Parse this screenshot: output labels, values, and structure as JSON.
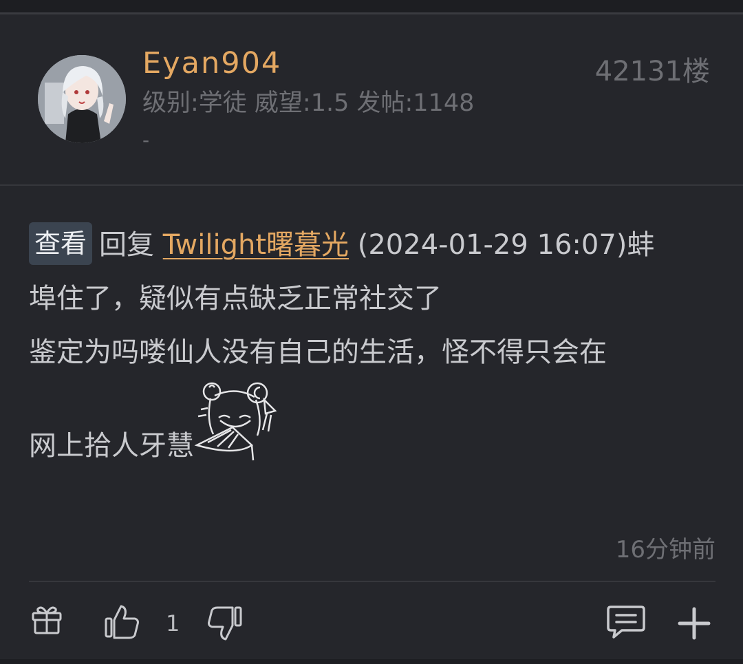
{
  "post": {
    "username": "Eyan904",
    "floor": "42131楼",
    "meta": "级别:学徒 威望:1.5 发帖:1148",
    "signature": "-",
    "view_button": "查看",
    "reply_prefix": "回复",
    "mention": "Twilight曙暮光",
    "reply_time": "(2024-01-29 16:07)",
    "line1_tail": "蚌",
    "line2": "埠住了，疑似有点缺乏正常社交了",
    "line3": "鉴定为吗喽仙人没有自己的生活，怪不得只会在",
    "line4": "网上拾人牙慧",
    "time_ago": "16分钟前",
    "like_count": "1"
  },
  "icons": {
    "gift": "gift-icon",
    "like": "thumbs-up-icon",
    "dislike": "thumbs-down-icon",
    "comment": "comment-icon",
    "more": "plus-icon"
  },
  "colors": {
    "background": "#25262b",
    "username": "#e4a862",
    "text": "#c9cace",
    "muted": "#6e6f74"
  }
}
